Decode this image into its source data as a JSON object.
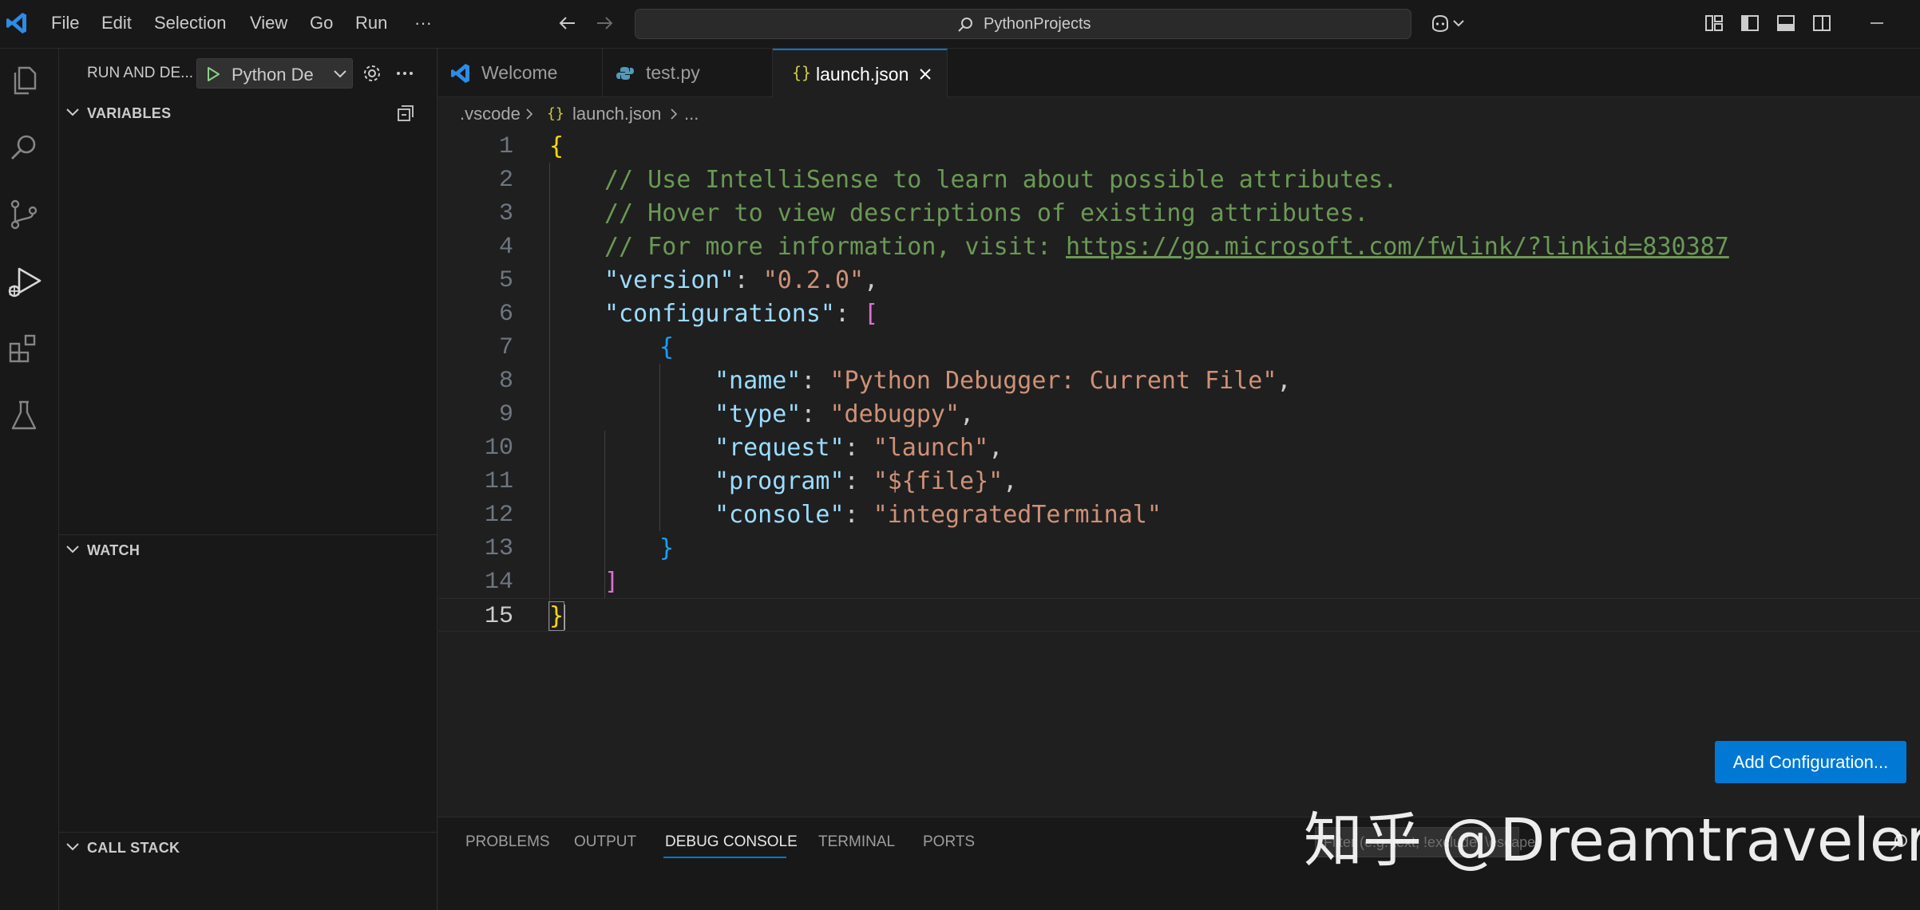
{
  "titlebar": {
    "menus": [
      "File",
      "Edit",
      "Selection",
      "View",
      "Go",
      "Run",
      "···"
    ],
    "command_center_text": "PythonProjects"
  },
  "sidebar": {
    "title": "RUN AND DE...",
    "debug_config_label": "Python De",
    "sections": {
      "variables": "VARIABLES",
      "watch": "WATCH",
      "call_stack": "CALL STACK"
    }
  },
  "tabs": [
    {
      "label": "Welcome",
      "icon": "vscode-icon",
      "active": false
    },
    {
      "label": "test.py",
      "icon": "python-icon",
      "active": false
    },
    {
      "label": "launch.json",
      "icon": "json-braces-icon",
      "active": true
    }
  ],
  "breadcrumb": [
    ".vscode",
    "{}",
    "launch.json",
    "..."
  ],
  "editor": {
    "line_numbers": [
      "1",
      "2",
      "3",
      "4",
      "5",
      "6",
      "7",
      "8",
      "9",
      "10",
      "11",
      "12",
      "13",
      "14",
      "15"
    ],
    "current_line": "15",
    "code": {
      "l1": "{",
      "l2": "// Use IntelliSense to learn about possible attributes.",
      "l3": "// Hover to view descriptions of existing attributes.",
      "l4_prefix": "// For more information, visit: ",
      "l4_link": "https://go.microsoft.com/fwlink/?linkid=830387",
      "l5_key": "\"version\"",
      "l5_val": "\"0.2.0\"",
      "l6_key": "\"configurations\"",
      "l6_bracket": "[",
      "l7": "{",
      "l8_key": "\"name\"",
      "l8_val": "\"Python Debugger: Current File\"",
      "l9_key": "\"type\"",
      "l9_val": "\"debugpy\"",
      "l10_key": "\"request\"",
      "l10_val": "\"launch\"",
      "l11_key": "\"program\"",
      "l11_val": "\"${file}\"",
      "l12_key": "\"console\"",
      "l12_val": "\"integratedTerminal\"",
      "l13": "}",
      "l14": "]",
      "l15": "}"
    }
  },
  "add_configuration_button": "Add Configuration...",
  "panel": {
    "tabs": [
      "PROBLEMS",
      "OUTPUT",
      "DEBUG CONSOLE",
      "TERMINAL",
      "PORTS"
    ],
    "active_tab": "DEBUG CONSOLE",
    "filter_placeholder": "Filter (e.g. text, !exclude, \\escape)"
  },
  "watermark": "知乎 @Dreamtraveler",
  "colors": {
    "accent": "#0078d4",
    "comment": "#6a9955",
    "key": "#9cdcfe",
    "string": "#ce9178",
    "brace_level1": "#ffd700",
    "brace_level2": "#da70d6",
    "brace_level3": "#179fff"
  }
}
